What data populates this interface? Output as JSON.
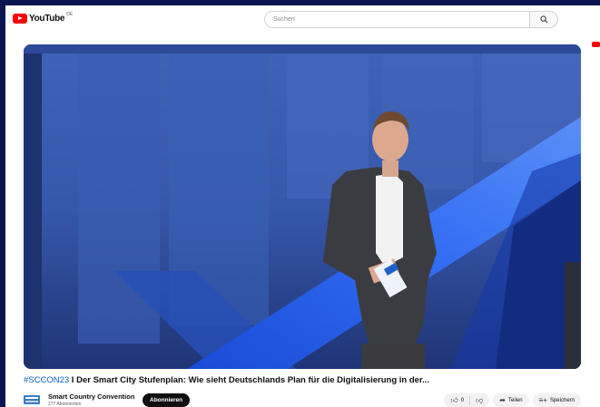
{
  "header": {
    "logo_text": "YouTube",
    "logo_region": "DE",
    "search_placeholder": "Suchen"
  },
  "video": {
    "title_tag": "#SCCON23",
    "title_rest": " I Der Smart City Stufenplan: Wie sieht Deutschlands Plan für die Digitalisierung in der..."
  },
  "channel": {
    "name": "Smart Country Convention",
    "subscribers": "277 Abonnenten",
    "subscribe_label": "Abonnieren"
  },
  "actions": {
    "like_count": "0",
    "share_label": "Teilen",
    "save_label": "Speichern"
  },
  "icons": [
    "youtube-logo-icon",
    "search-icon",
    "like-icon",
    "dislike-icon",
    "share-icon",
    "save-icon"
  ],
  "colors": {
    "brand": "#ff0000",
    "page_border": "#0a1650",
    "link": "#065fd4"
  }
}
